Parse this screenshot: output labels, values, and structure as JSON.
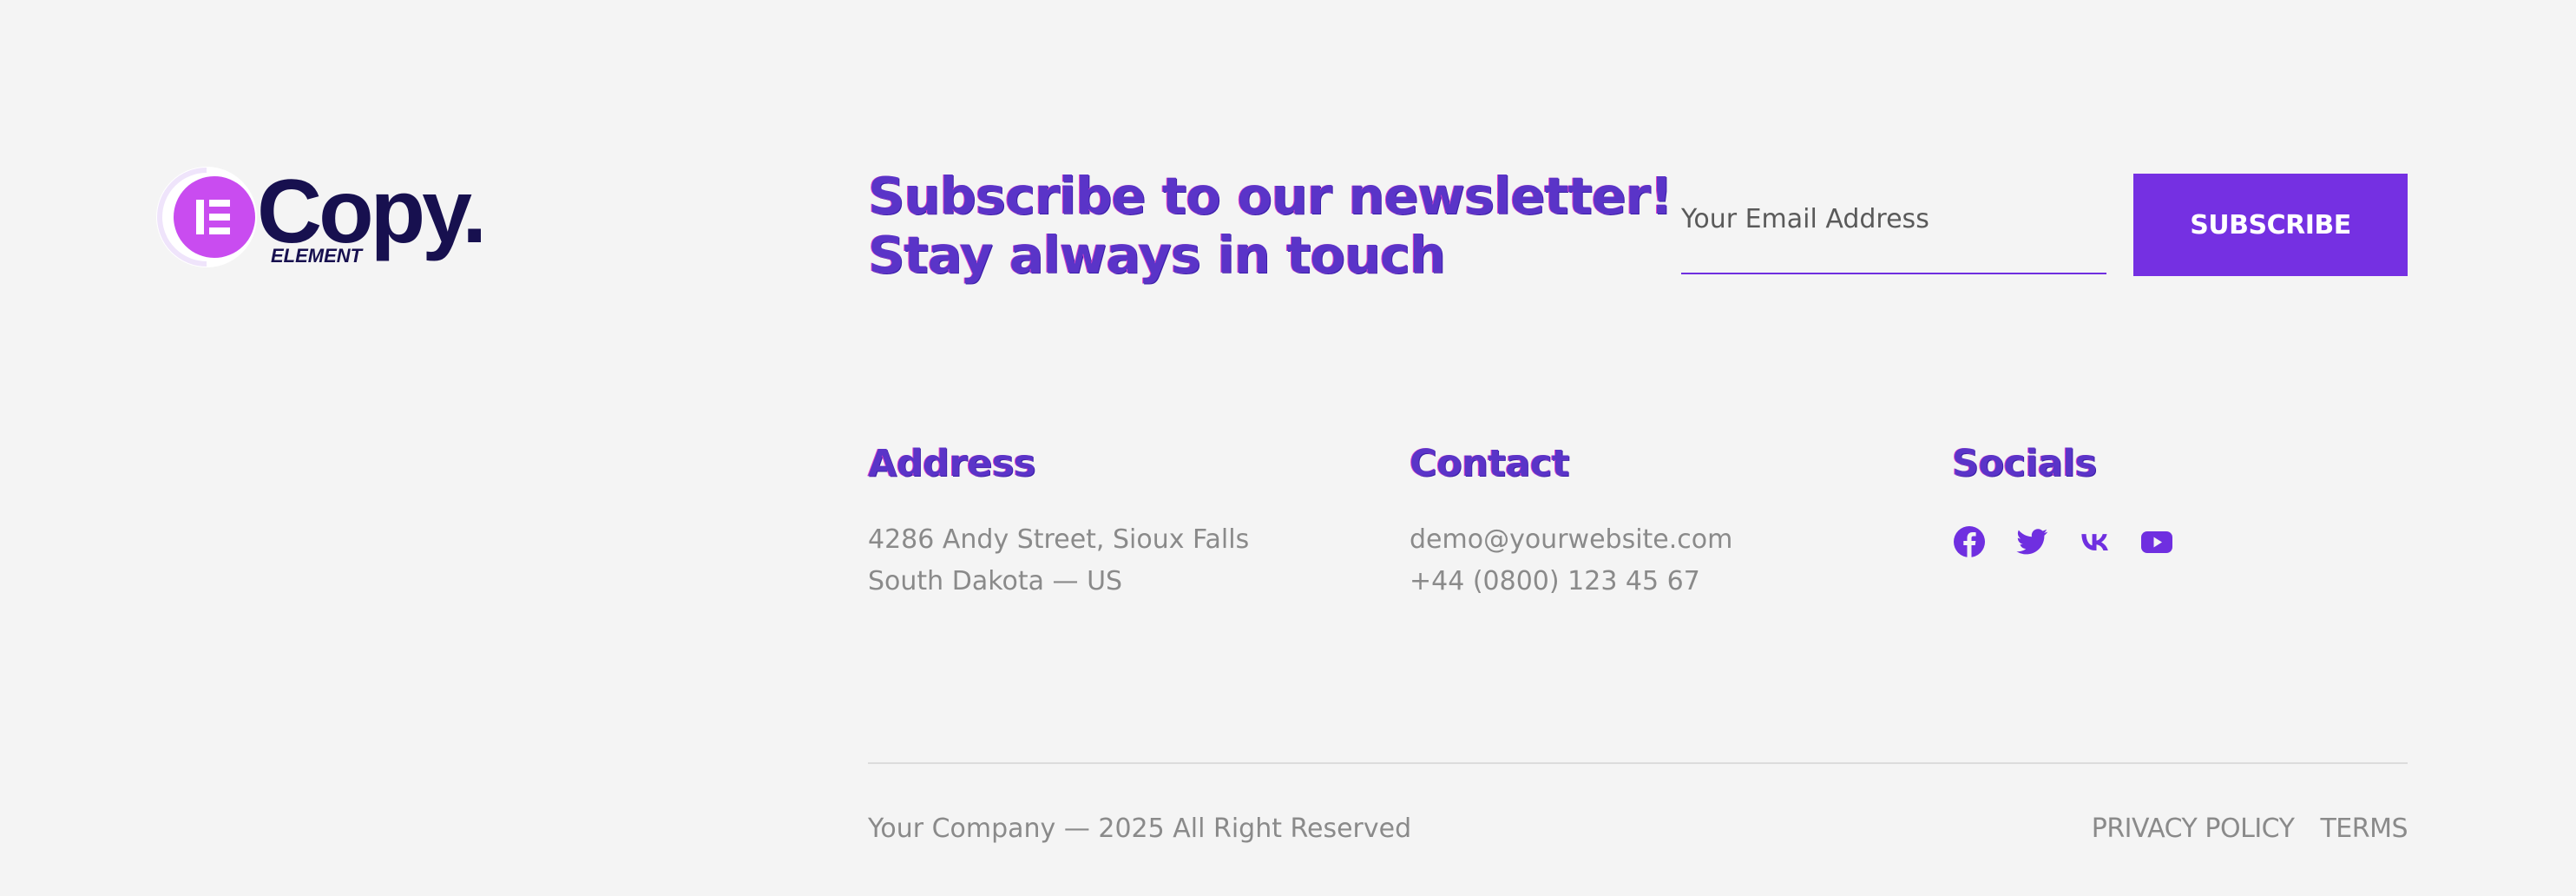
{
  "brand": {
    "name": "Copy.",
    "sub": "ELEMENT",
    "colors": {
      "dark": "#17104f",
      "magenta": "#c94cf0",
      "purple": "#7530e2"
    }
  },
  "newsletter": {
    "title_line1": "Subscribe to our newsletter!",
    "title_line2": "Stay always in touch",
    "email_placeholder": "Your Email Address",
    "button_label": "SUBSCRIBE"
  },
  "address": {
    "title": "Address",
    "line1": "4286 Andy Street, Sioux Falls",
    "line2": "South Dakota — US"
  },
  "contact": {
    "title": "Contact",
    "email": "demo@yourwebsite.com",
    "phone": "+44 (0800) 123 45 67"
  },
  "socials": {
    "title": "Socials",
    "icons": [
      "facebook-icon",
      "twitter-icon",
      "vk-icon",
      "youtube-icon"
    ]
  },
  "footer": {
    "copyright": "Your Company — 2025 All Right Reserved",
    "privacy_label": "PRIVACY POLICY",
    "terms_label": "TERMS"
  }
}
